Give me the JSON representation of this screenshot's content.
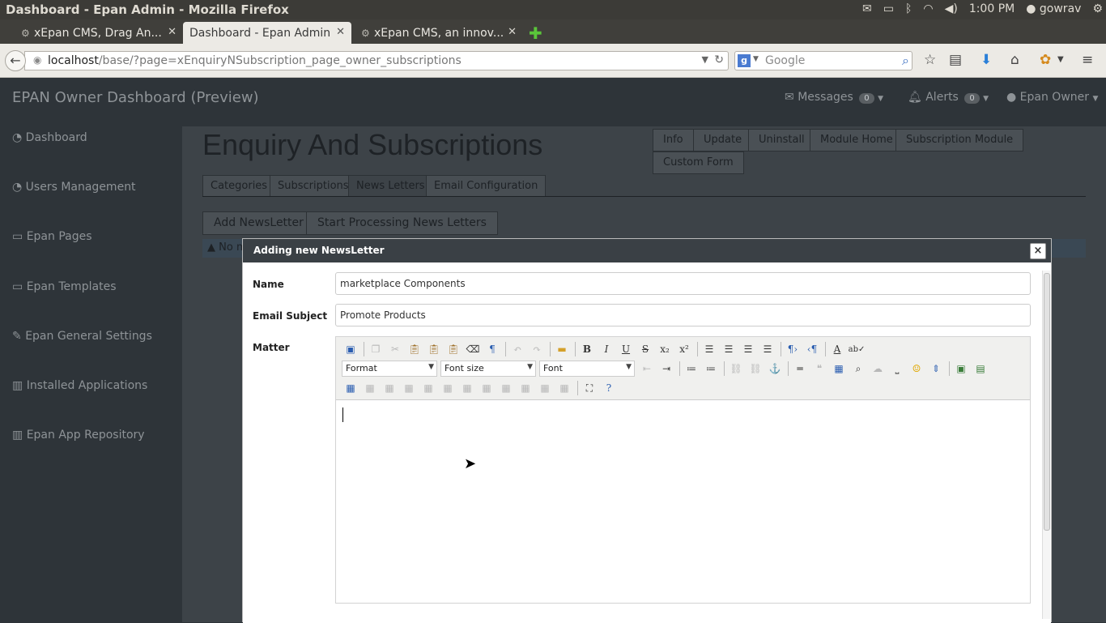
{
  "os": {
    "window_title": "Dashboard - Epan Admin - Mozilla Firefox",
    "time": "1:00 PM",
    "user": "gowrav"
  },
  "browser": {
    "tabs": [
      {
        "label": "xEpan CMS, Drag An...",
        "active": false
      },
      {
        "label": "Dashboard - Epan Admin",
        "active": true
      },
      {
        "label": "xEpan CMS, an innov...",
        "active": false
      }
    ],
    "url_host": "localhost",
    "url_path": "/base/?page=xEnquiryNSubscription_page_owner_subscriptions",
    "search_placeholder": "Google"
  },
  "app": {
    "brand": "EPAN Owner Dashboard (Preview)",
    "header": {
      "messages_label": "Messages",
      "messages_count": "0",
      "alerts_label": "Alerts",
      "alerts_count": "0",
      "user_label": "Epan Owner"
    },
    "sidebar": {
      "items": [
        {
          "label": "Dashboard",
          "icon": "dashboard-icon"
        },
        {
          "label": "Users Management",
          "icon": "dashboard-icon"
        },
        {
          "label": "Epan Pages",
          "icon": "desktop-icon"
        },
        {
          "label": "Epan Templates",
          "icon": "desktop-icon"
        },
        {
          "label": "Epan General Settings",
          "icon": "wrench-icon"
        },
        {
          "label": "Installed Applications",
          "icon": "bar-chart-icon"
        },
        {
          "label": "Epan App Repository",
          "icon": "bar-chart-icon"
        }
      ]
    },
    "page_title": "Enquiry And Subscriptions",
    "module_buttons": [
      "Info",
      "Update",
      "Uninstall",
      "Module Home",
      "Subscription Module",
      "Custom Form"
    ],
    "tabs": [
      "Categories",
      "Subscriptions",
      "News Letters",
      "Email Configuration"
    ],
    "active_tab": "News Letters",
    "actions": [
      "Add NewsLetter",
      "Start Processing News Letters"
    ],
    "notice_text": "No m"
  },
  "dialog": {
    "title": "Adding new NewsLetter",
    "close_label": "×",
    "fields": {
      "name_label": "Name",
      "name_value": "marketplace Components",
      "subject_label": "Email Subject",
      "subject_value": "Promote Products",
      "matter_label": "Matter"
    },
    "editor": {
      "format_label": "Format",
      "font_size_label": "Font size",
      "font_label": "Font"
    }
  }
}
